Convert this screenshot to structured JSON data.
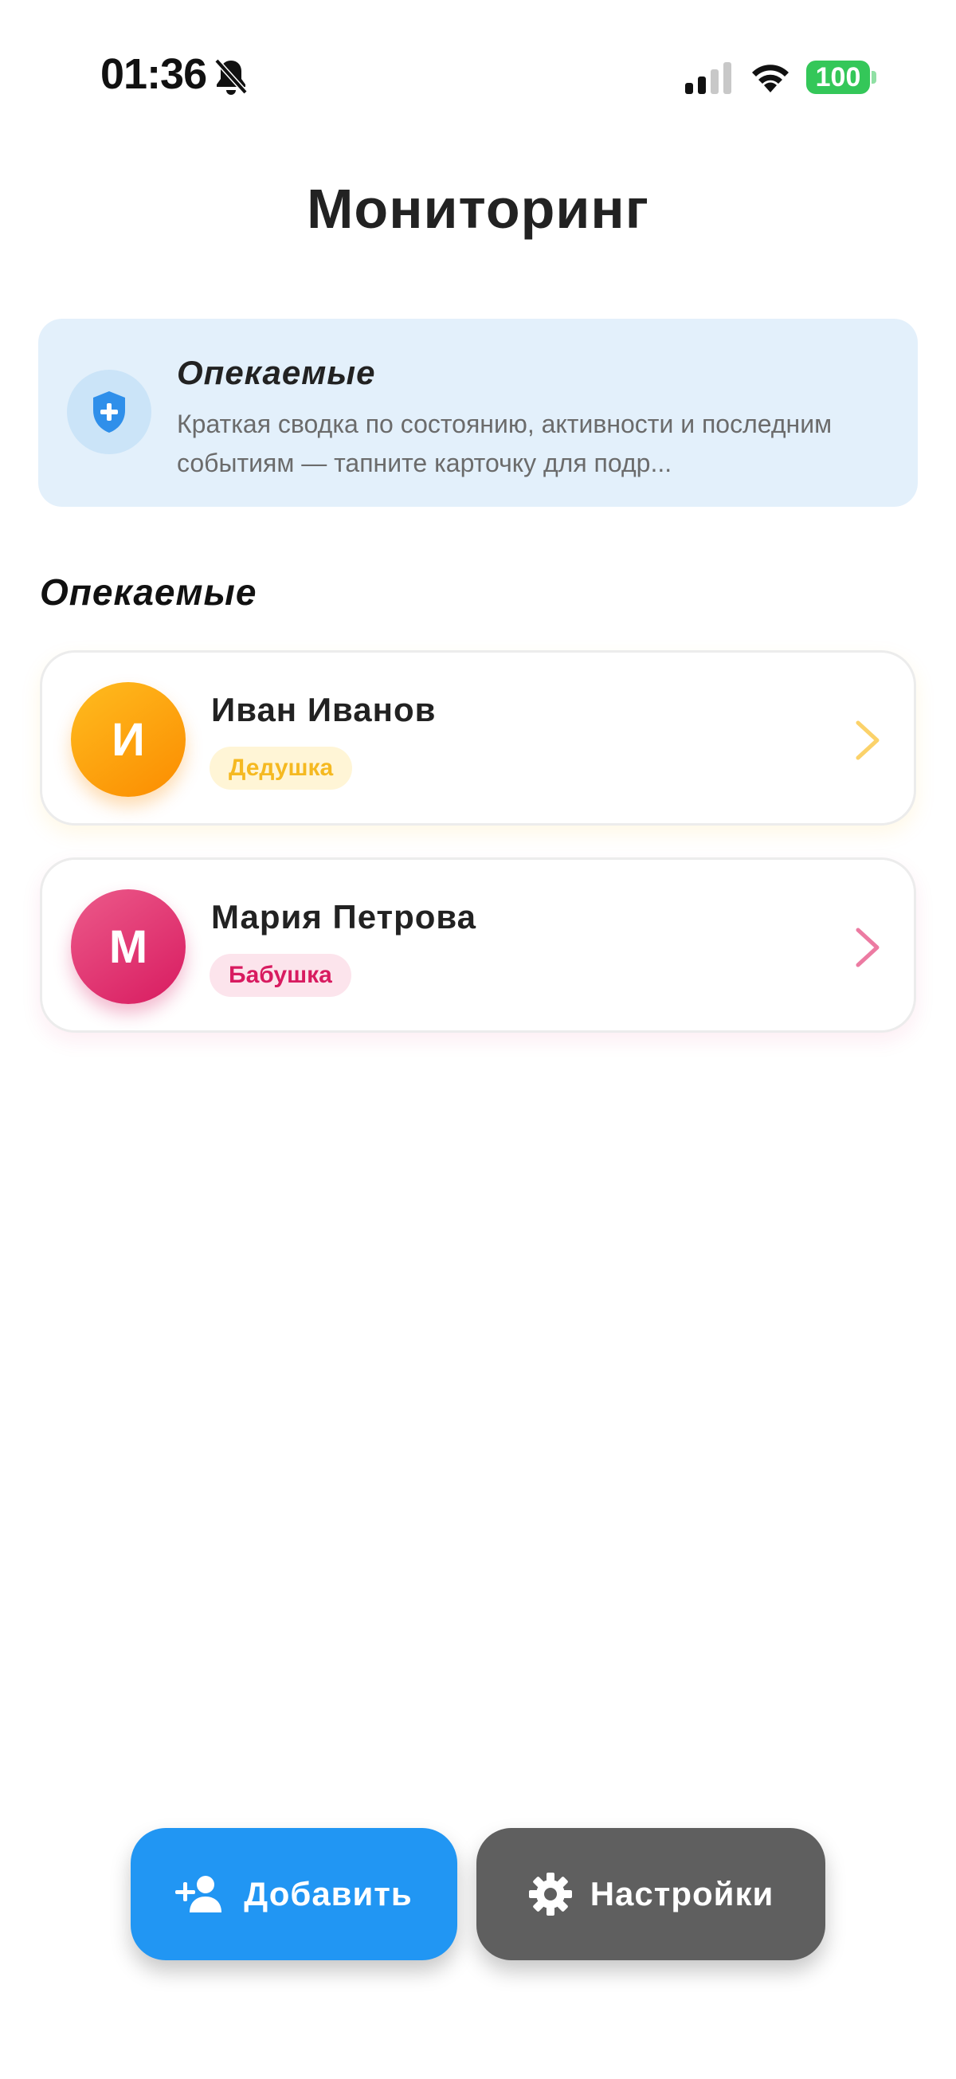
{
  "status_bar": {
    "time": "01:36",
    "battery": "100",
    "icons": [
      "bell-off-icon",
      "cellular-signal-icon",
      "wifi-icon",
      "battery-icon"
    ]
  },
  "header": {
    "title": "Мониторинг"
  },
  "info_card": {
    "icon": "shield-plus-icon",
    "title": "Опекаемые",
    "description": "Краткая сводка по состоянию, активности и последним событиям — тапните карточку для подр..."
  },
  "section": {
    "title": "Опекаемые"
  },
  "wards": [
    {
      "initial": "И",
      "name": "Иван Иванов",
      "relation": "Дедушка",
      "accent": "#fb8c00"
    },
    {
      "initial": "М",
      "name": "Мария Петрова",
      "relation": "Бабушка",
      "accent": "#d81b60"
    }
  ],
  "actions": {
    "add_label": "Добавить",
    "add_icon": "person-add-icon",
    "settings_label": "Настройки",
    "settings_icon": "gear-icon",
    "add_color": "#2196f3",
    "settings_color": "#5f5f5f"
  },
  "colors": {
    "info_bg": "#e3f0fb",
    "shield": "#2f8fea",
    "battery": "#34c759"
  }
}
